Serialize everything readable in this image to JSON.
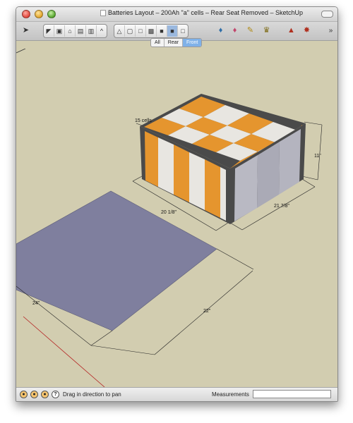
{
  "window": {
    "title": "Batteries Layout – 200Ah \"a\" cells – Rear Seat Removed – SketchUp"
  },
  "toolbar": {
    "tools": [
      "select-arrow-icon",
      "get-models-icon",
      "make-component-icon",
      "home-view-icon",
      "top-view-icon",
      "front-view-icon",
      "right-view-icon",
      "perspective-view-icon",
      "xray-icon",
      "wireframe-icon",
      "hidden-line-icon",
      "shaded-icon",
      "shaded-textures-icon",
      "monochrome-icon",
      "paint-bucket-icon",
      "eraser-icon",
      "tape-measure-icon",
      "walk-icon",
      "section-plane-icon",
      "component-browser-icon",
      "toolbar-overflow-icon"
    ]
  },
  "scenes": {
    "tabs": [
      "All",
      "Rear",
      "Front"
    ],
    "active": "Front"
  },
  "model": {
    "cell_count_label": "15 cells",
    "box_height_label": "11\"",
    "box_width_label": "20 1/8\"",
    "box_depth_label": "21 7/8\"",
    "floor_width_label": "24\"",
    "floor_depth_label": "22\"",
    "colors": {
      "background": "#d2cdb0",
      "orange": "#e5952e",
      "white": "#e8e6e1",
      "box_edge": "#4a4a4a",
      "side_panel": "#b9b9c3",
      "floor": "#7f7f9e"
    }
  },
  "status": {
    "hint": "Drag in direction to pan",
    "measurements_label": "Measurements",
    "measurements_value": ""
  }
}
